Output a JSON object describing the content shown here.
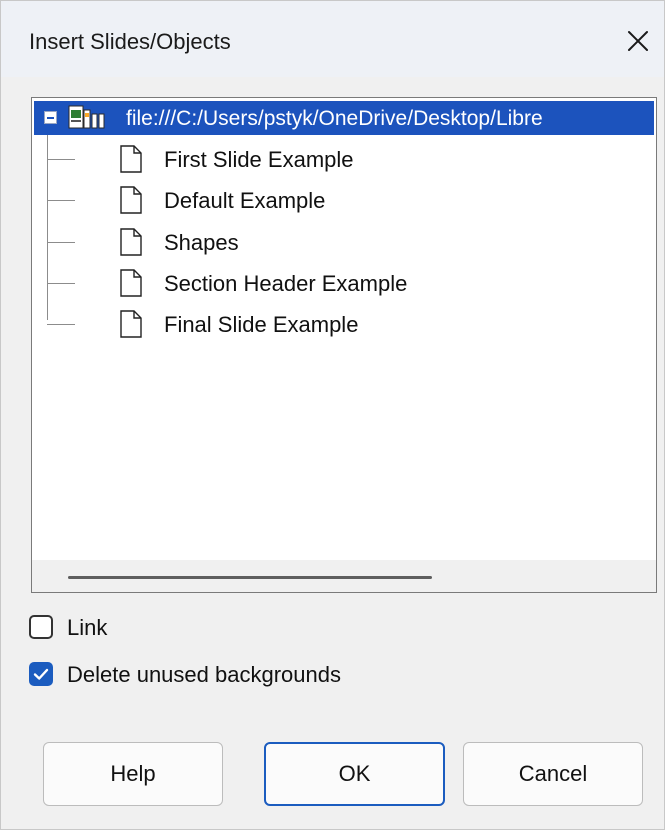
{
  "dialog": {
    "title": "Insert Slides/Objects",
    "close_icon": "close-icon"
  },
  "tree": {
    "root": {
      "label": "file:///C:/Users/pstyk/OneDrive/Desktop/Libre",
      "expanded": true,
      "selected": true,
      "icon": "presentation-file-icon"
    },
    "items": [
      {
        "label": "First Slide Example",
        "icon": "document-icon"
      },
      {
        "label": "Default Example",
        "icon": "document-icon"
      },
      {
        "label": "Shapes",
        "icon": "document-icon"
      },
      {
        "label": "Section Header Example",
        "icon": "document-icon"
      },
      {
        "label": "Final Slide Example",
        "icon": "document-icon"
      }
    ]
  },
  "options": {
    "link": {
      "label": "Link",
      "checked": false
    },
    "delete_unused": {
      "label": "Delete unused backgrounds",
      "checked": true
    }
  },
  "buttons": {
    "help": "Help",
    "ok": "OK",
    "cancel": "Cancel"
  },
  "colors": {
    "selection": "#1c53bd",
    "accent": "#1b5cbf"
  }
}
